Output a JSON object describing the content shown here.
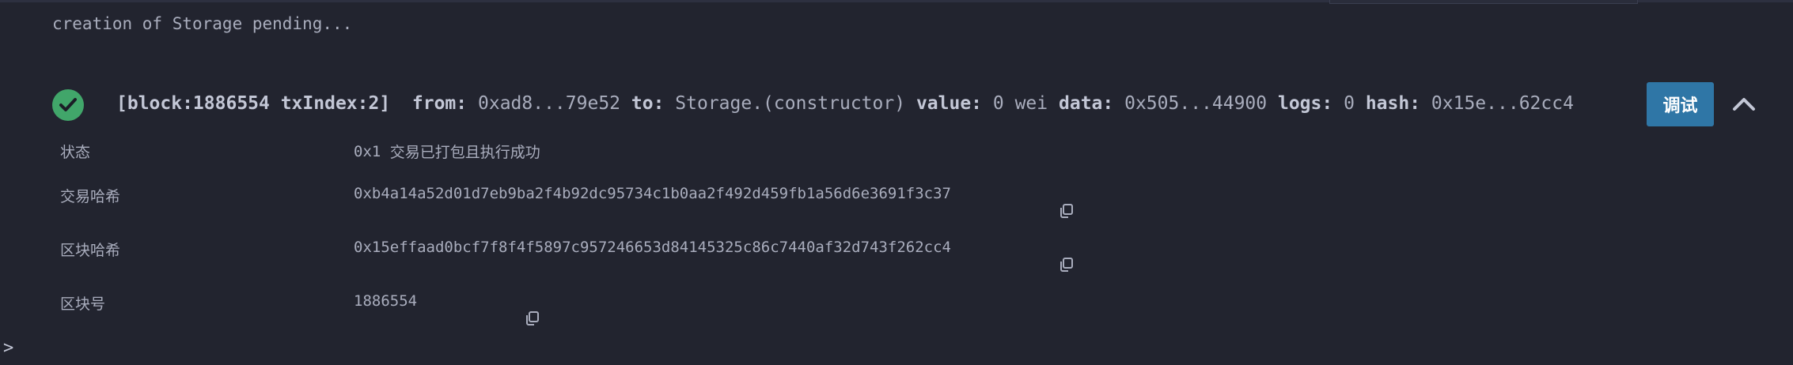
{
  "log": {
    "pending_message": "creation of Storage pending..."
  },
  "transaction": {
    "block_label": "[block:1886554 txIndex:2]",
    "from_key": "from:",
    "from_value": "0xad8...79e52",
    "to_key": "to:",
    "to_value": "Storage.(constructor)",
    "value_key": "value:",
    "value_value": "0 wei",
    "data_key": "data:",
    "data_value": "0x505...44900",
    "logs_key": "logs:",
    "logs_value": "0",
    "hash_key": "hash:",
    "hash_value": "0x15e...62cc4",
    "debug_label": "调试",
    "status_color": "#41a66a",
    "debug_color": "#2f76a6"
  },
  "details": [
    {
      "label": "状态",
      "value_code": "0x1",
      "value_text": "交易已打包且执行成功"
    },
    {
      "label": "交易哈希",
      "value": "0xb4a14a52d01d7eb9ba2f4b92dc95734c1b0aa2f492d459fb1a56d6e3691f3c37"
    },
    {
      "label": "区块哈希",
      "value": "0x15effaad0bcf7f8f4f5897c957246653d84145325c86c7440af32d743f262cc4"
    },
    {
      "label": "区块号",
      "value": "1886554"
    }
  ],
  "console": {
    "prompt": ">"
  },
  "icons": {
    "status": "check-circle-icon",
    "collapse": "chevron-up-icon",
    "copy": "copy-icon"
  }
}
